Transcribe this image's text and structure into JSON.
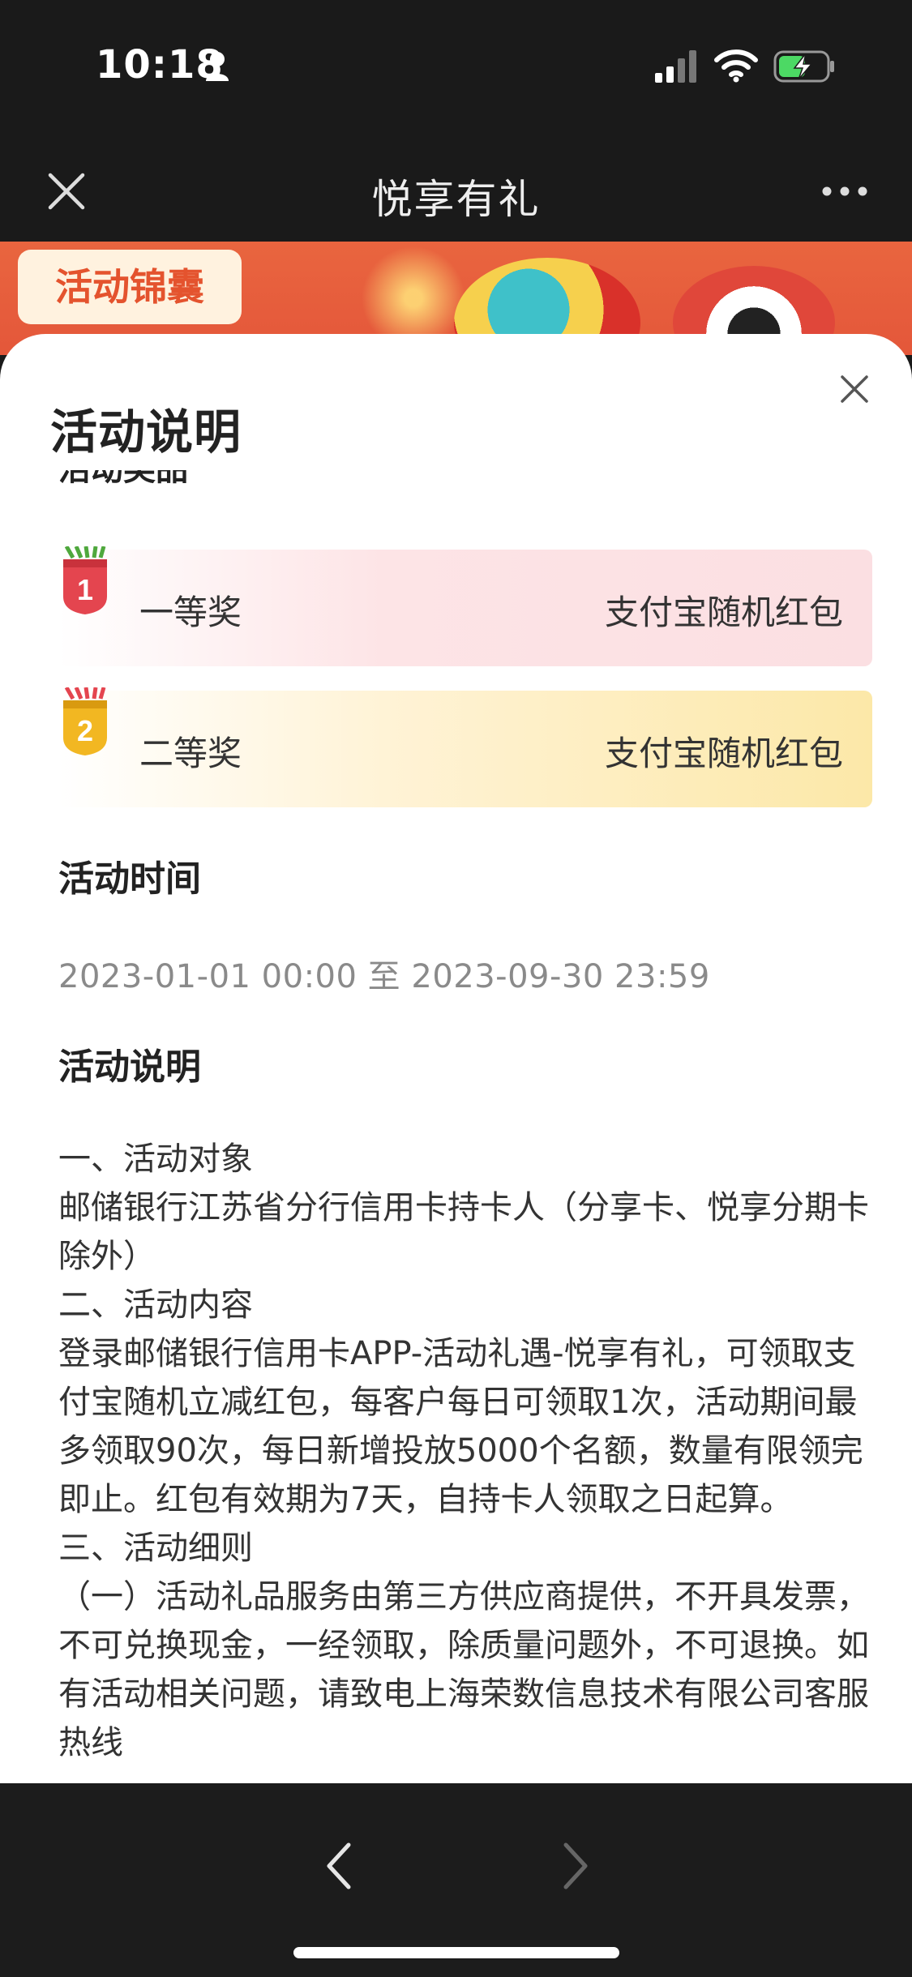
{
  "status_bar": {
    "time": "10:18"
  },
  "nav": {
    "title": "悦享有礼"
  },
  "banner": {
    "tag": "活动锦囊"
  },
  "sheet": {
    "title": "活动说明",
    "clipped_heading": "活动奖品",
    "prizes": [
      {
        "medal": "1",
        "name": "一等奖",
        "reward": "支付宝随机红包"
      },
      {
        "medal": "2",
        "name": "二等奖",
        "reward": "支付宝随机红包"
      }
    ],
    "time_heading": "活动时间",
    "time_range": "2023-01-01 00:00 至 2023-09-30 23:59",
    "desc_heading": "活动说明",
    "desc_lines": [
      "一、活动对象",
      "邮储银行江苏省分行信用卡持卡人（分享卡、悦享分期卡除外）",
      "二、活动内容",
      "登录邮储银行信用卡APP-活动礼遇-悦享有礼，可领取支付宝随机立减红包，每客户每日可领取1次，活动期间最多领取90次，每日新增投放5000个名额，数量有限领完即止。红包有效期为7天，自持卡人领取之日起算。",
      "三、活动细则",
      "（一）活动礼品服务由第三方供应商提供，不开具发票，不可兑换现金，一经领取，除质量问题外，不可退换。如有活动相关问题，请致电上海荣数信息技术有限公司客服热线"
    ]
  },
  "colors": {
    "prize1_bg": "#fbdfe2",
    "prize2_bg": "#fce8a8",
    "medal1": "#e4454f",
    "medal2": "#f2b722",
    "banner": "#e4573a"
  }
}
